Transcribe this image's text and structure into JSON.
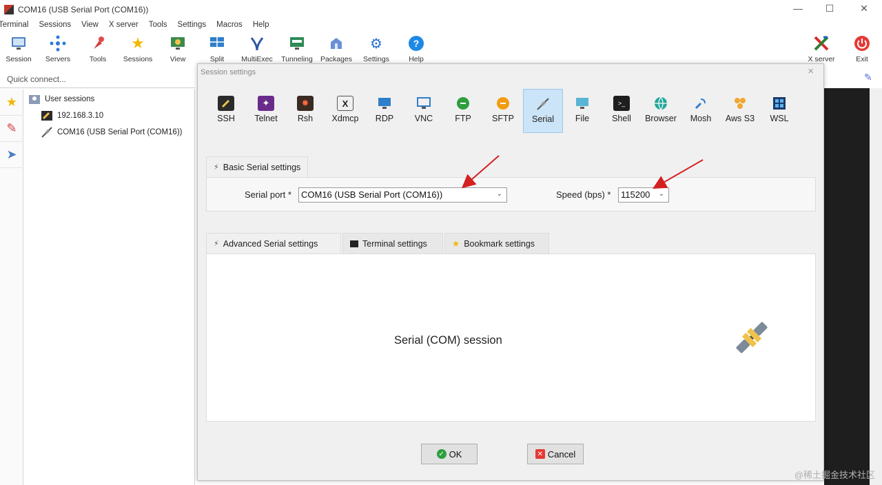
{
  "window": {
    "title": "COM16  (USB Serial Port (COM16))",
    "minimize": "—",
    "maximize": "☐",
    "close": "✕"
  },
  "menu": [
    "Terminal",
    "Sessions",
    "View",
    "X server",
    "Tools",
    "Settings",
    "Macros",
    "Help"
  ],
  "toolbar": {
    "session": "Session",
    "servers": "Servers",
    "tools": "Tools",
    "sessions": "Sessions",
    "view": "View",
    "split": "Split",
    "multiexec": "MultiExec",
    "tunneling": "Tunneling",
    "packages": "Packages",
    "settings": "Settings",
    "help": "Help",
    "xserver": "X server",
    "exit": "Exit"
  },
  "left": {
    "quick_connect": "Quick connect...",
    "tree": {
      "root": "User sessions",
      "item1": "192.168.3.10",
      "item2": "COM16  (USB Serial Port (COM16))"
    }
  },
  "dialog": {
    "title": "Session settings",
    "close": "×",
    "protocols": {
      "ssh": "SSH",
      "telnet": "Telnet",
      "rsh": "Rsh",
      "xdmcp": "Xdmcp",
      "rdp": "RDP",
      "vnc": "VNC",
      "ftp": "FTP",
      "sftp": "SFTP",
      "serial": "Serial",
      "file": "File",
      "shell": "Shell",
      "browser": "Browser",
      "mosh": "Mosh",
      "aws_s3": "Aws S3",
      "wsl": "WSL"
    },
    "basic": {
      "tab": "Basic Serial settings",
      "serial_port_label": "Serial port *",
      "serial_port_value": "COM16  (USB Serial Port (COM16))",
      "speed_label": "Speed (bps) *",
      "speed_value": "115200"
    },
    "tabs": {
      "advanced": "Advanced Serial settings",
      "terminal": "Terminal settings",
      "bookmark": "Bookmark settings"
    },
    "panel_text": "Serial (COM) session",
    "ok": "OK",
    "cancel": "Cancel"
  },
  "watermark": "@稀土掘金技术社区",
  "colors": {
    "active_tab_bg": "#cce4f7",
    "annotation_arrow": "#d42020",
    "terminal_bg": "#1e1e1e"
  }
}
